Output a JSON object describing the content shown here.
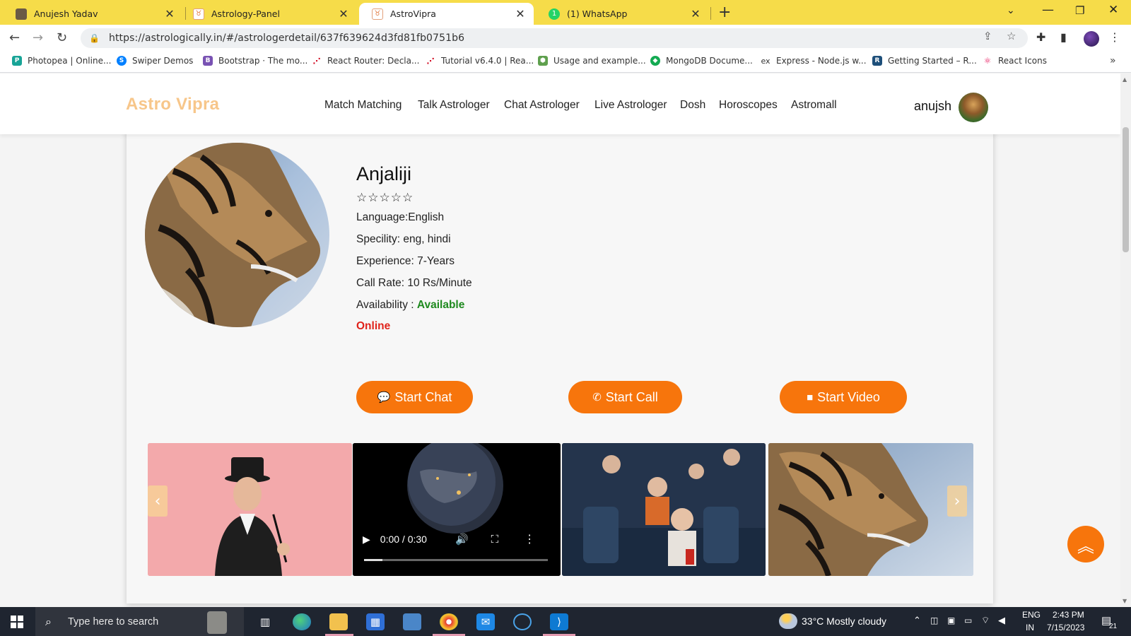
{
  "browser": {
    "tabs": [
      {
        "label": "Anujesh Yadav",
        "active": false
      },
      {
        "label": "Astrology-Panel",
        "active": false
      },
      {
        "label": "AstroVipra",
        "active": true
      },
      {
        "label": "(1) WhatsApp",
        "active": false
      }
    ],
    "url": "https://astrologically.in/#/astrologerdetail/637f639624d3fd81fb0751b6",
    "bookmarks": [
      {
        "label": "Photopea | Online...",
        "icon": "photopea-icon",
        "color": "#18a497"
      },
      {
        "label": "Swiper Demos",
        "icon": "swiper-icon",
        "color": "#0080ff"
      },
      {
        "label": "Bootstrap · The mo...",
        "icon": "bootstrap-icon",
        "color": "#7952b3"
      },
      {
        "label": "React Router: Decla...",
        "icon": "react-router-icon",
        "color": "#d0021b"
      },
      {
        "label": "Tutorial v6.4.0 | Rea...",
        "icon": "react-router-icon",
        "color": "#d0021b"
      },
      {
        "label": "Usage and example...",
        "icon": "node-icon",
        "color": "#5fa04e"
      },
      {
        "label": "MongoDB Docume...",
        "icon": "mongodb-icon",
        "color": "#13aa52"
      },
      {
        "label": "Express - Node.js w...",
        "icon": "express-icon",
        "color": "#333333"
      },
      {
        "label": "Getting Started – R...",
        "icon": "redux-icon",
        "color": "#1e4f7a"
      },
      {
        "label": "React Icons",
        "icon": "react-icon",
        "color": "#e91e63"
      }
    ]
  },
  "site": {
    "logo": "Astro Vipra",
    "nav": [
      "Match Matching",
      "Talk Astrologer",
      "Chat Astrologer",
      "Live Astrologer",
      "Dosh",
      "Horoscopes",
      "Astromall"
    ],
    "user": "anujsh",
    "accent_color": "#f7750c"
  },
  "astrologer": {
    "name": "Anjaliji",
    "rating_stars": 0,
    "rating_max": 5,
    "language": "Language:English",
    "speciality": "Specility: eng, hindi",
    "experience": "Experience: 7-Years",
    "call_rate": "Call Rate: 10 Rs/Minute",
    "availability_label": "Availability : ",
    "availability_value": "Available",
    "status": "Online"
  },
  "actions": {
    "chat": "Start Chat",
    "call": "Start Call",
    "video": "Start Video"
  },
  "gallery": {
    "video_time": "0:00 / 0:30",
    "video_progress": 0.1
  },
  "taskbar": {
    "search_placeholder": "Type here to search",
    "weather": "33°C  Mostly cloudy",
    "lang": "ENG",
    "region": "IN",
    "time": "2:43 PM",
    "date": "7/15/2023",
    "notifications": "21"
  }
}
